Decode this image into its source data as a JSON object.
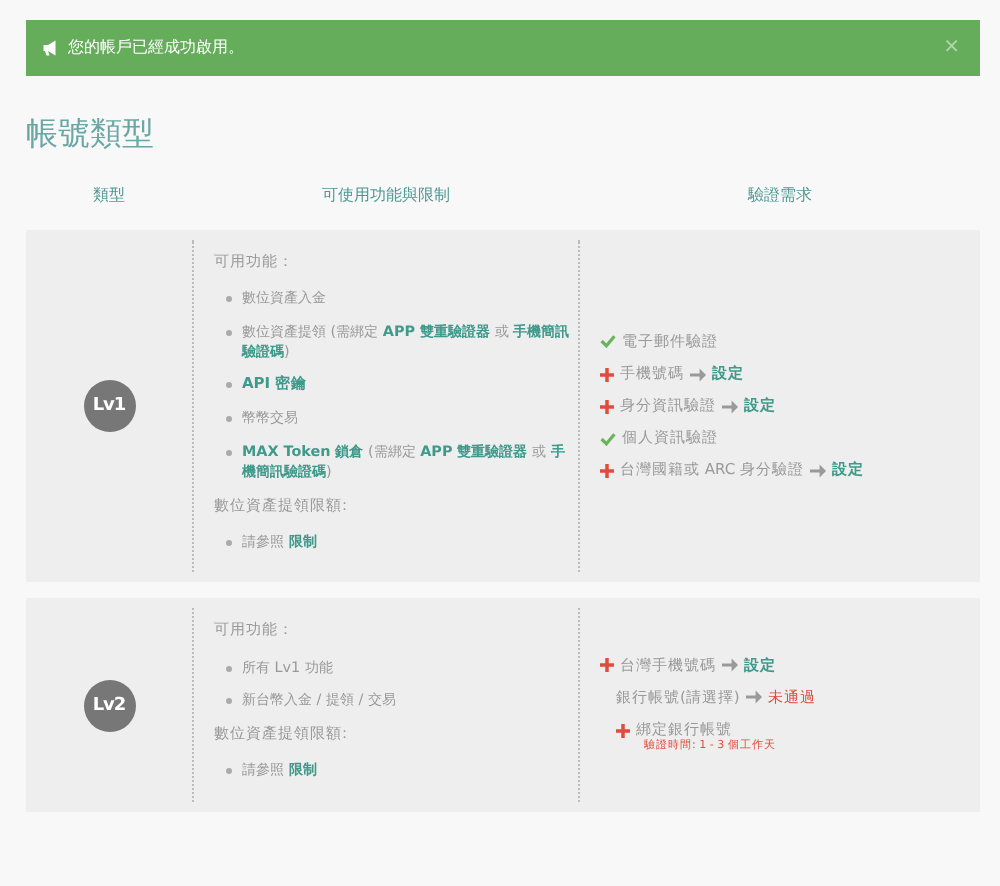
{
  "alert": {
    "message": "您的帳戶已經成功啟用。",
    "close": "×"
  },
  "title": "帳號類型",
  "columns": [
    "類型",
    "可使用功能與限制",
    "驗證需求"
  ],
  "levels": [
    {
      "badge": "Lv1",
      "features_heading": "可用功能：",
      "features": [
        {
          "kind": "text",
          "text": "數位資產入金"
        },
        {
          "kind": "text",
          "text": "數位資產提領 (需綁定 **APP 雙重驗證器** 或 **手機簡訊驗證碼**)"
        },
        {
          "kind": "link",
          "text": "API 密鑰"
        },
        {
          "kind": "text",
          "text": "幣幣交易"
        },
        {
          "kind": "text",
          "text": "**MAX Token 鎖倉** (需綁定 **APP 雙重驗證器** 或 **手機簡訊驗證碼**)"
        }
      ],
      "limits_heading": "數位資產提領限額:",
      "limits": [
        {
          "text": "請參照 **限制**"
        }
      ],
      "requirements": [
        {
          "kind": "done",
          "label": "電子郵件驗證"
        },
        {
          "kind": "todo",
          "label": "手機號碼",
          "action": {
            "text": "設定",
            "kind": "link"
          }
        },
        {
          "kind": "todo",
          "label": "身分資訊驗證",
          "action": {
            "text": "設定",
            "kind": "link"
          }
        },
        {
          "kind": "done",
          "label": "個人資訊驗證"
        },
        {
          "kind": "todo",
          "label": "台灣國籍或 ARC 身分驗證",
          "action": {
            "text": "設定",
            "kind": "link"
          }
        }
      ]
    },
    {
      "badge": "Lv2",
      "features_heading": "可用功能：",
      "features": [
        {
          "kind": "text",
          "text": "所有 Lv1 功能"
        },
        {
          "kind": "text",
          "text": "新台幣入金 / 提領 / 交易"
        }
      ],
      "limits_heading": "數位資產提領限額:",
      "limits": [
        {
          "text": "請參照 **限制**"
        }
      ],
      "requirements": [
        {
          "kind": "todo",
          "label": "台灣手機號碼",
          "action": {
            "text": "設定",
            "kind": "link"
          }
        },
        {
          "kind": "none",
          "label": "銀行帳號(請選擇)",
          "action": {
            "text": "未通過",
            "kind": "error"
          }
        },
        {
          "kind": "sub",
          "label": "綁定銀行帳號",
          "note": "驗證時間: 1 - 3 個工作天"
        }
      ]
    }
  ]
}
